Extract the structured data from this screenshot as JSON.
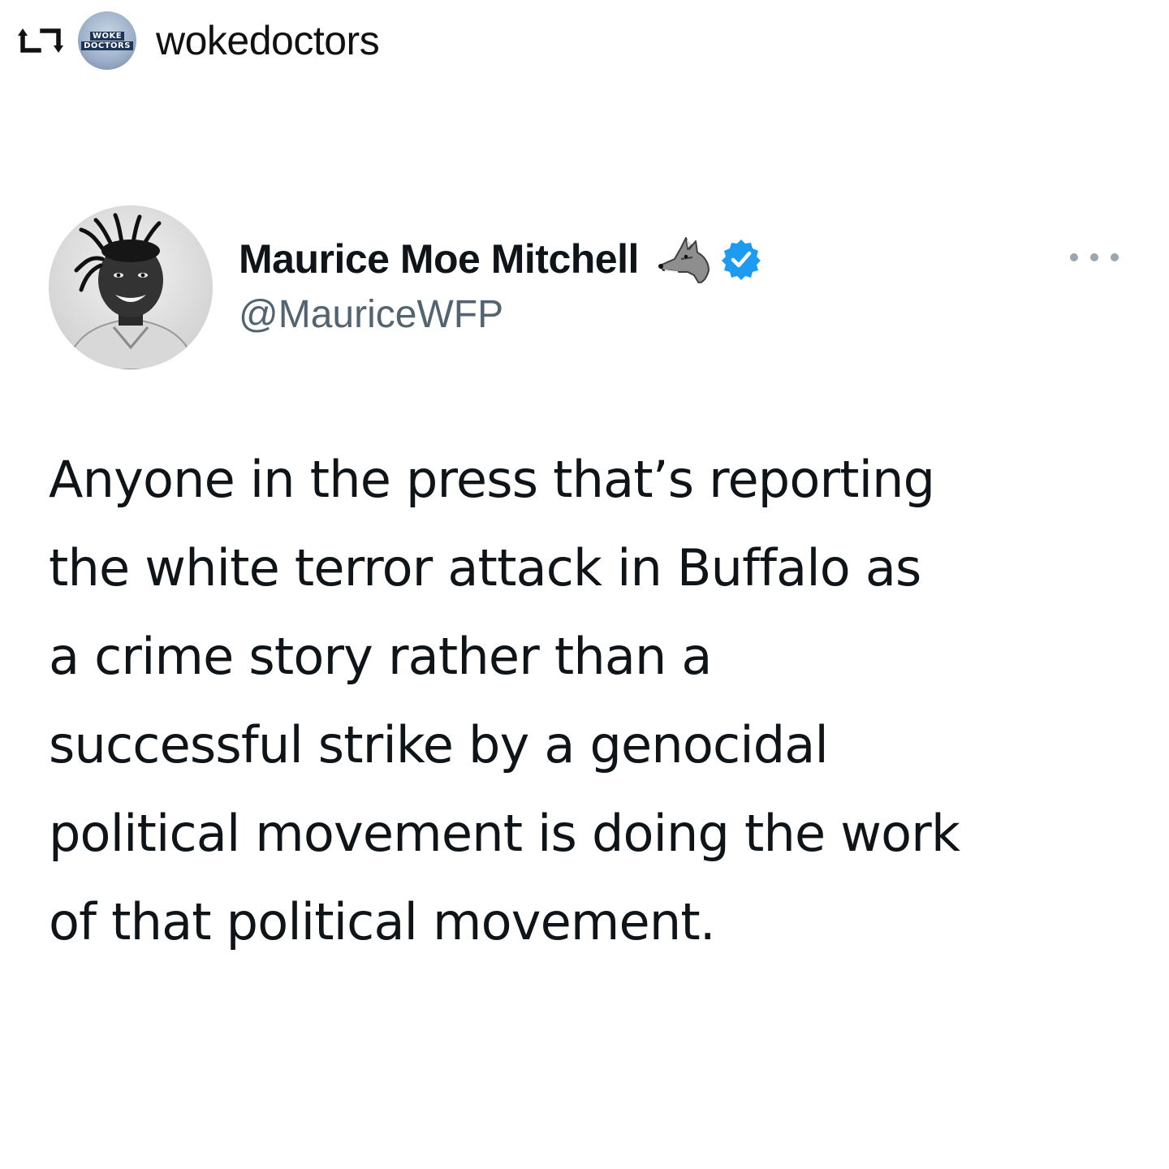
{
  "repost": {
    "username": "wokedoctors",
    "avatar_logo_line1": "WOKE",
    "avatar_logo_line2": "DOCTORS",
    "icon": "repost-icon"
  },
  "tweet": {
    "display_name": "Maurice Moe Mitchell",
    "handle": "@MauriceWFP",
    "name_emoji": "wolf-icon",
    "verified_badge": "verified-icon",
    "more_menu": "more-options-icon",
    "text": "Anyone in the press that’s reporting\nthe white terror attack in Buffalo as\na crime story rather than a\nsuccessful strike by a genocidal\npolitical movement is doing the work\nof that political movement."
  },
  "colors": {
    "verified_blue": "#1d9bf0",
    "handle_gray": "#536471",
    "text_dark": "#0f1419",
    "more_dots": "#9aa6b2"
  }
}
